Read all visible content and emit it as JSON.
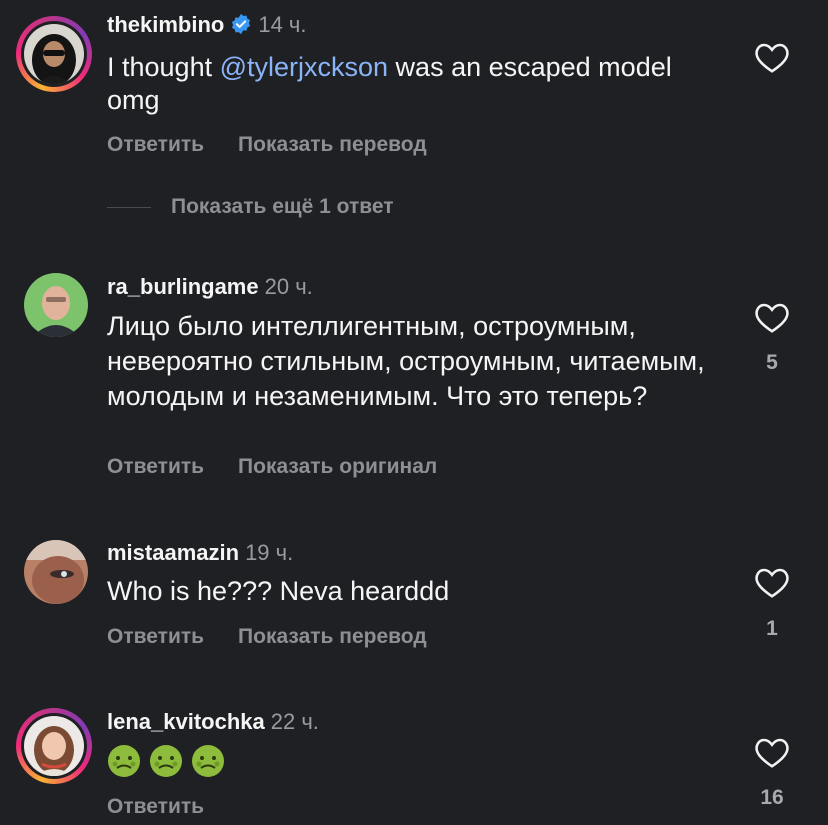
{
  "comments": [
    {
      "username": "thekimbino",
      "time": "14 ч.",
      "text_before": "I thought ",
      "mention": "@tylerjxckson",
      "text_after": " was an escaped model omg",
      "reply_label": "Ответить",
      "secondary_action": "Показать перевод",
      "more_replies": "Показать ещё 1 ответ",
      "verified": true
    },
    {
      "username": "ra_burlingame",
      "time": "20 ч.",
      "text": "Лицо было интеллигентным, остроумным, невероятно стильным, остроумным, читаемым, молодым и незаменимым. Что это теперь?",
      "reply_label": "Ответить",
      "secondary_action": "Показать оригинал",
      "likes": "5"
    },
    {
      "username": "mistaamazin",
      "time": "19 ч.",
      "text": "Who is he??? Neva hearddd",
      "reply_label": "Ответить",
      "secondary_action": "Показать перевод",
      "likes": "1"
    },
    {
      "username": "lena_kvitochka",
      "time": "22 ч.",
      "emojis": [
        "nauseated-face-emoji",
        "nauseated-face-emoji",
        "nauseated-face-emoji"
      ],
      "reply_label": "Ответить",
      "likes": "16"
    }
  ],
  "colors": {
    "background": "#1f2023",
    "mention": "#8ab4f8",
    "verified": "#3897f0",
    "muted": "#8e8f94"
  }
}
